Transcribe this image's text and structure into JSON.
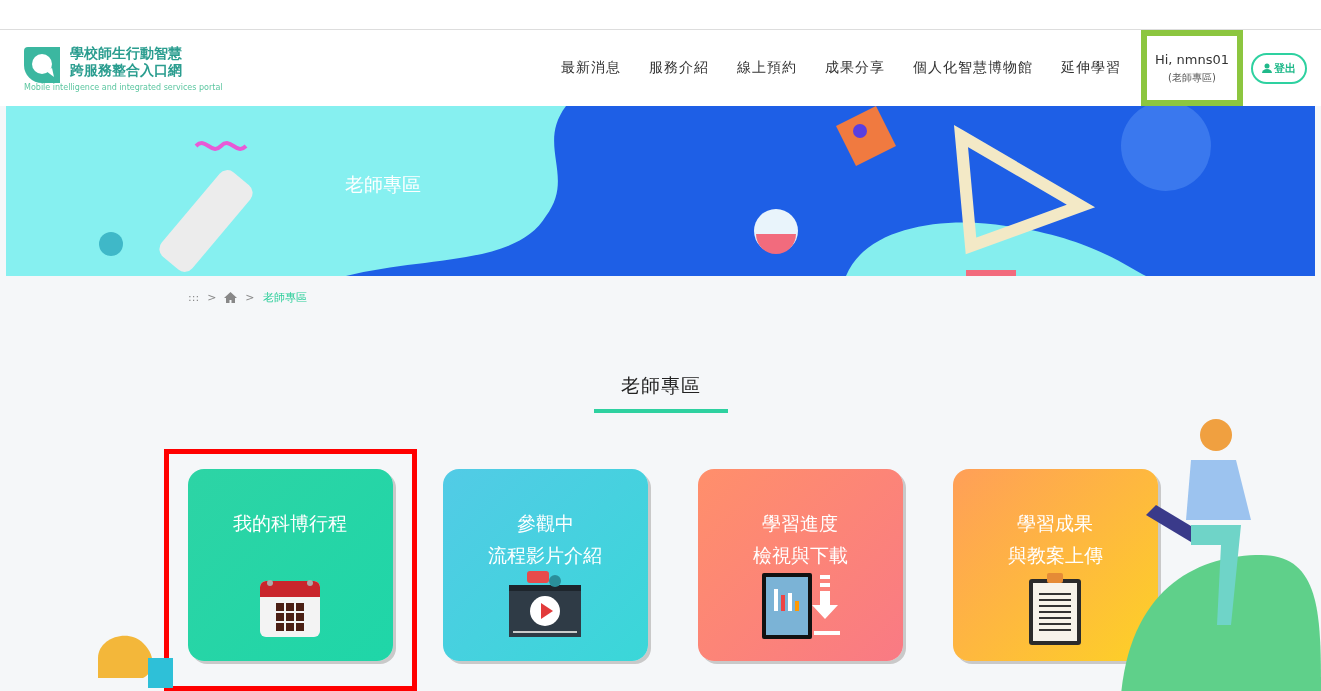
{
  "header": {
    "logo": {
      "title_lines": [
        "學校師生行動智慧",
        "跨服務整合入口網"
      ],
      "subtitle": "Mobile intelligence and integrated services portal"
    },
    "nav": [
      "最新消息",
      "服務介紹",
      "線上預約",
      "成果分享",
      "個人化智慧博物館",
      "延伸學習"
    ],
    "user": {
      "greeting": "Hi, nmns01",
      "role": "(老師專區)",
      "highlighted": true
    },
    "logout": "登出"
  },
  "banner": {
    "title": "老師專區"
  },
  "breadcrumb": {
    "dots": ":::",
    "separators": [
      ">",
      ">"
    ],
    "current": "老師專區"
  },
  "section_title": "老師專區",
  "cards": [
    {
      "kind": "calendar",
      "lines": [
        "我的科博行程"
      ],
      "highlighted": true
    },
    {
      "kind": "video",
      "lines": [
        "參觀中",
        "流程影片介紹"
      ],
      "highlighted": false
    },
    {
      "kind": "download",
      "lines": [
        "學習進度",
        "檢視與下載"
      ],
      "highlighted": false
    },
    {
      "kind": "clipboard",
      "lines": [
        "學習成果",
        "與教案上傳"
      ],
      "highlighted": false
    }
  ]
}
